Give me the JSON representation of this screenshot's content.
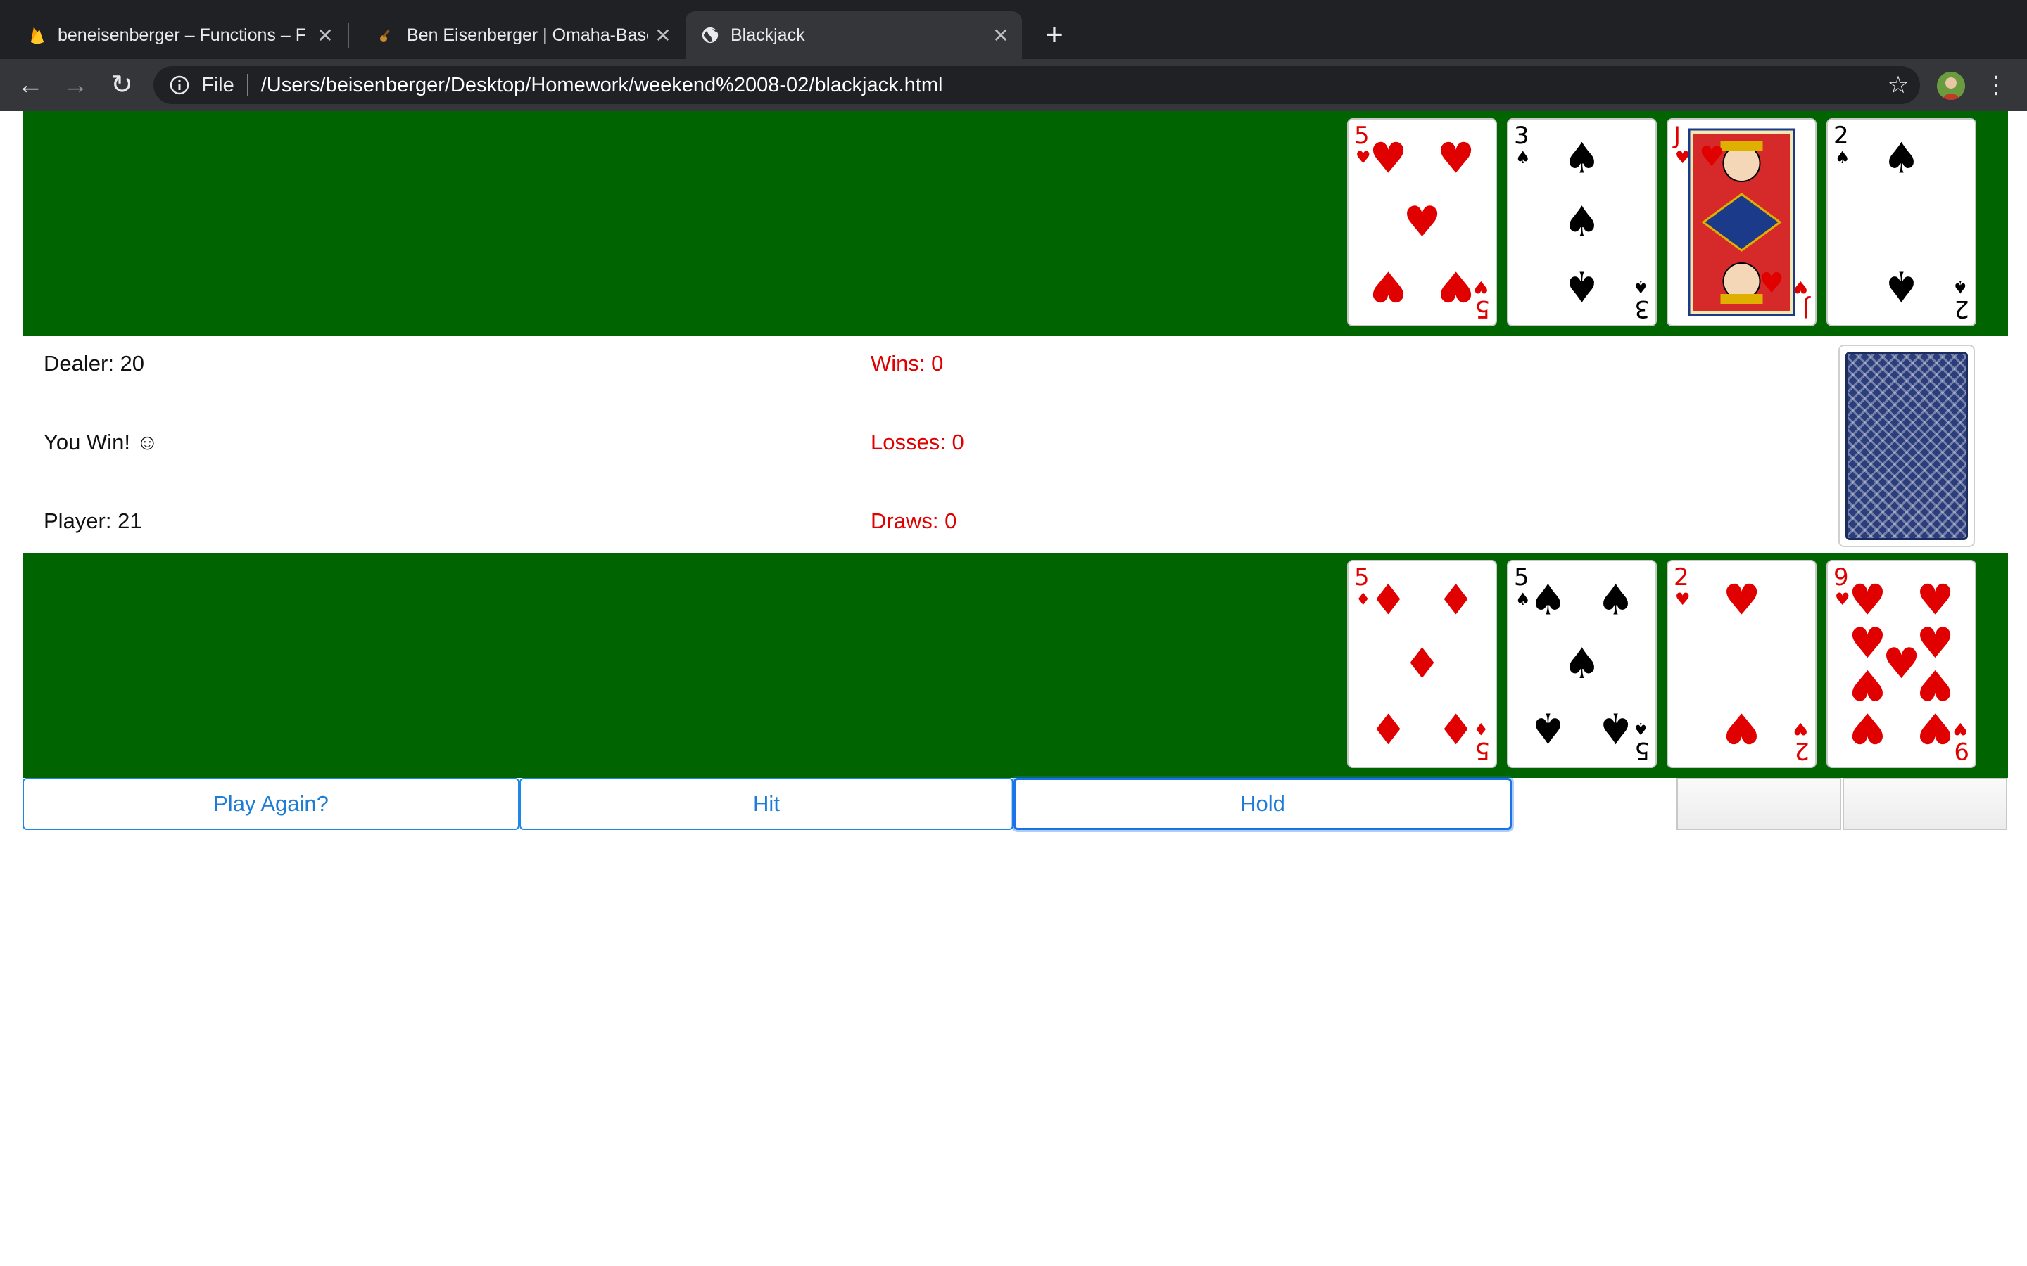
{
  "browser": {
    "tabs": [
      {
        "title": "beneisenberger – Functions – F",
        "active": false
      },
      {
        "title": "Ben Eisenberger | Omaha-Base",
        "active": false
      },
      {
        "title": "Blackjack",
        "active": true
      }
    ],
    "omnibox": {
      "scheme": "File",
      "url": "/Users/beisenberger/Desktop/Homework/weekend%2008-02/blackjack.html"
    }
  },
  "game": {
    "dealer_cards": [
      {
        "rank": "5",
        "suit": "hearts"
      },
      {
        "rank": "3",
        "suit": "spades"
      },
      {
        "rank": "J",
        "suit": "hearts"
      },
      {
        "rank": "2",
        "suit": "spades"
      }
    ],
    "player_cards": [
      {
        "rank": "5",
        "suit": "diamonds"
      },
      {
        "rank": "5",
        "suit": "spades"
      },
      {
        "rank": "2",
        "suit": "hearts"
      },
      {
        "rank": "9",
        "suit": "hearts"
      }
    ],
    "dealer_score": "Dealer: 20",
    "result": "You Win! ☺",
    "player_score": "Player: 21",
    "wins": "Wins: 0",
    "losses": "Losses: 0",
    "draws": "Draws: 0"
  },
  "controls": {
    "play_again": "Play Again?",
    "hit": "Hit",
    "hold": "Hold"
  },
  "colors": {
    "felt": "#006400",
    "stats_red": "#e00000",
    "button_blue": "#1e7bd6",
    "card_red": "#e00000",
    "card_black": "#000000"
  }
}
